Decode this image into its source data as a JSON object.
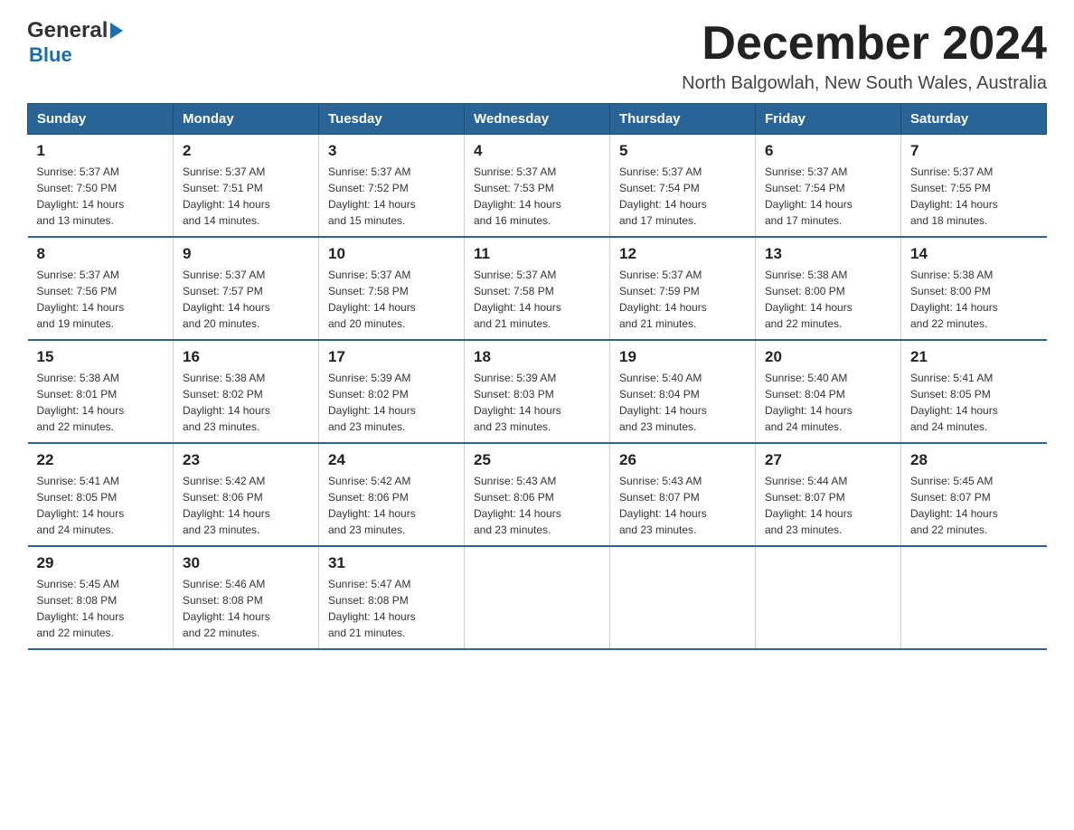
{
  "header": {
    "logo_general": "General",
    "logo_blue": "Blue",
    "month_title": "December 2024",
    "location": "North Balgowlah, New South Wales, Australia"
  },
  "days_of_week": [
    "Sunday",
    "Monday",
    "Tuesday",
    "Wednesday",
    "Thursday",
    "Friday",
    "Saturday"
  ],
  "weeks": [
    [
      {
        "day": "1",
        "sunrise": "5:37 AM",
        "sunset": "7:50 PM",
        "daylight": "14 hours and 13 minutes."
      },
      {
        "day": "2",
        "sunrise": "5:37 AM",
        "sunset": "7:51 PM",
        "daylight": "14 hours and 14 minutes."
      },
      {
        "day": "3",
        "sunrise": "5:37 AM",
        "sunset": "7:52 PM",
        "daylight": "14 hours and 15 minutes."
      },
      {
        "day": "4",
        "sunrise": "5:37 AM",
        "sunset": "7:53 PM",
        "daylight": "14 hours and 16 minutes."
      },
      {
        "day": "5",
        "sunrise": "5:37 AM",
        "sunset": "7:54 PM",
        "daylight": "14 hours and 17 minutes."
      },
      {
        "day": "6",
        "sunrise": "5:37 AM",
        "sunset": "7:54 PM",
        "daylight": "14 hours and 17 minutes."
      },
      {
        "day": "7",
        "sunrise": "5:37 AM",
        "sunset": "7:55 PM",
        "daylight": "14 hours and 18 minutes."
      }
    ],
    [
      {
        "day": "8",
        "sunrise": "5:37 AM",
        "sunset": "7:56 PM",
        "daylight": "14 hours and 19 minutes."
      },
      {
        "day": "9",
        "sunrise": "5:37 AM",
        "sunset": "7:57 PM",
        "daylight": "14 hours and 20 minutes."
      },
      {
        "day": "10",
        "sunrise": "5:37 AM",
        "sunset": "7:58 PM",
        "daylight": "14 hours and 20 minutes."
      },
      {
        "day": "11",
        "sunrise": "5:37 AM",
        "sunset": "7:58 PM",
        "daylight": "14 hours and 21 minutes."
      },
      {
        "day": "12",
        "sunrise": "5:37 AM",
        "sunset": "7:59 PM",
        "daylight": "14 hours and 21 minutes."
      },
      {
        "day": "13",
        "sunrise": "5:38 AM",
        "sunset": "8:00 PM",
        "daylight": "14 hours and 22 minutes."
      },
      {
        "day": "14",
        "sunrise": "5:38 AM",
        "sunset": "8:00 PM",
        "daylight": "14 hours and 22 minutes."
      }
    ],
    [
      {
        "day": "15",
        "sunrise": "5:38 AM",
        "sunset": "8:01 PM",
        "daylight": "14 hours and 22 minutes."
      },
      {
        "day": "16",
        "sunrise": "5:38 AM",
        "sunset": "8:02 PM",
        "daylight": "14 hours and 23 minutes."
      },
      {
        "day": "17",
        "sunrise": "5:39 AM",
        "sunset": "8:02 PM",
        "daylight": "14 hours and 23 minutes."
      },
      {
        "day": "18",
        "sunrise": "5:39 AM",
        "sunset": "8:03 PM",
        "daylight": "14 hours and 23 minutes."
      },
      {
        "day": "19",
        "sunrise": "5:40 AM",
        "sunset": "8:04 PM",
        "daylight": "14 hours and 23 minutes."
      },
      {
        "day": "20",
        "sunrise": "5:40 AM",
        "sunset": "8:04 PM",
        "daylight": "14 hours and 24 minutes."
      },
      {
        "day": "21",
        "sunrise": "5:41 AM",
        "sunset": "8:05 PM",
        "daylight": "14 hours and 24 minutes."
      }
    ],
    [
      {
        "day": "22",
        "sunrise": "5:41 AM",
        "sunset": "8:05 PM",
        "daylight": "14 hours and 24 minutes."
      },
      {
        "day": "23",
        "sunrise": "5:42 AM",
        "sunset": "8:06 PM",
        "daylight": "14 hours and 23 minutes."
      },
      {
        "day": "24",
        "sunrise": "5:42 AM",
        "sunset": "8:06 PM",
        "daylight": "14 hours and 23 minutes."
      },
      {
        "day": "25",
        "sunrise": "5:43 AM",
        "sunset": "8:06 PM",
        "daylight": "14 hours and 23 minutes."
      },
      {
        "day": "26",
        "sunrise": "5:43 AM",
        "sunset": "8:07 PM",
        "daylight": "14 hours and 23 minutes."
      },
      {
        "day": "27",
        "sunrise": "5:44 AM",
        "sunset": "8:07 PM",
        "daylight": "14 hours and 23 minutes."
      },
      {
        "day": "28",
        "sunrise": "5:45 AM",
        "sunset": "8:07 PM",
        "daylight": "14 hours and 22 minutes."
      }
    ],
    [
      {
        "day": "29",
        "sunrise": "5:45 AM",
        "sunset": "8:08 PM",
        "daylight": "14 hours and 22 minutes."
      },
      {
        "day": "30",
        "sunrise": "5:46 AM",
        "sunset": "8:08 PM",
        "daylight": "14 hours and 22 minutes."
      },
      {
        "day": "31",
        "sunrise": "5:47 AM",
        "sunset": "8:08 PM",
        "daylight": "14 hours and 21 minutes."
      },
      null,
      null,
      null,
      null
    ]
  ],
  "labels": {
    "sunrise": "Sunrise:",
    "sunset": "Sunset:",
    "daylight": "Daylight:"
  }
}
